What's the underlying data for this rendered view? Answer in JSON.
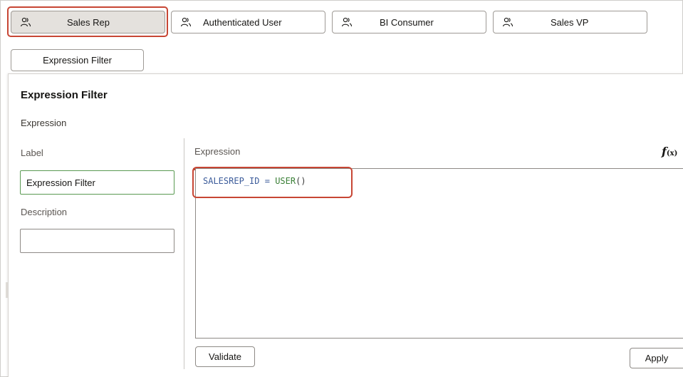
{
  "roles": [
    {
      "label": "Sales Rep",
      "active": true
    },
    {
      "label": "Authenticated User",
      "active": false
    },
    {
      "label": "BI Consumer",
      "active": false
    },
    {
      "label": "Sales VP",
      "active": false
    }
  ],
  "filter_tab": {
    "label": "Expression Filter"
  },
  "panel": {
    "title": "Expression Filter",
    "subtitle": "Expression",
    "label_caption": "Label",
    "label_value": "Expression Filter",
    "description_caption": "Description",
    "description_value": ""
  },
  "expression": {
    "caption": "Expression",
    "fx_glyph": "f",
    "fx_suffix": "(x)",
    "code": {
      "identifier": "SALESREP_ID",
      "operator": "=",
      "function": "USER",
      "parens": "()"
    }
  },
  "buttons": {
    "validate": "Validate",
    "apply": "Apply"
  },
  "colors": {
    "highlight": "#c74634",
    "active_tab_bg": "#e4e1dd",
    "focus_border": "#5a9a52"
  },
  "icons": {
    "role": "user-group-icon",
    "function": "function-fx-icon"
  }
}
